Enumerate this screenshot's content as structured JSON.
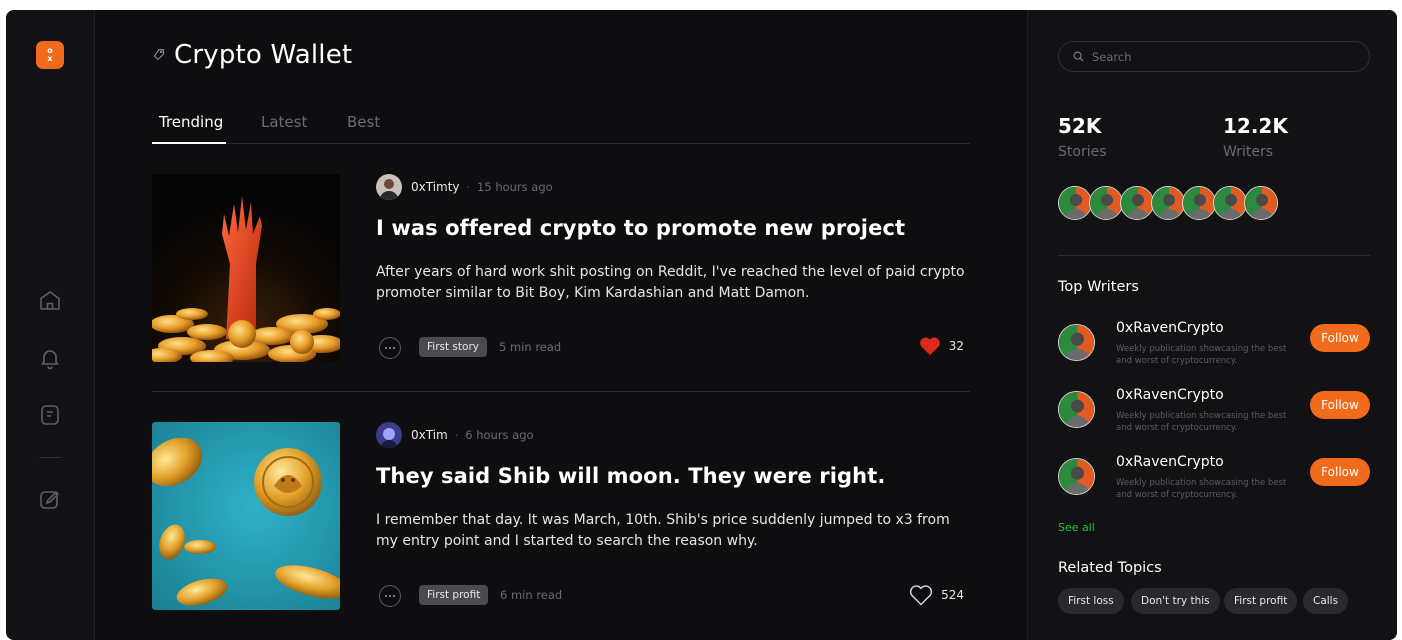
{
  "brand": {
    "logo_top": "o",
    "logo_bottom": "x",
    "accent": "#f26a1b"
  },
  "nav": {
    "items": [
      {
        "name": "home-icon"
      },
      {
        "name": "bell-icon"
      },
      {
        "name": "document-icon"
      },
      {
        "name": "edit-icon"
      }
    ]
  },
  "header": {
    "title": "Crypto Wallet",
    "icon": "tag-icon"
  },
  "tabs": [
    {
      "label": "Trending",
      "active": true
    },
    {
      "label": "Latest",
      "active": false
    },
    {
      "label": "Best",
      "active": false
    }
  ],
  "posts": [
    {
      "author": "0xTimty",
      "time": "15 hours ago",
      "title": "I was offered crypto to promote new project",
      "excerpt": "After years of hard work shit posting on Reddit, I've reached the level of paid crypto promoter similar to Bit Boy, Kim Kardashian and Matt Damon.",
      "tag": "First story",
      "read_time": "5 min read",
      "likes": "32",
      "liked": true
    },
    {
      "author": "0xTim",
      "time": "6 hours ago",
      "title": "They said Shib will moon. They were right.",
      "excerpt": "I remember that day. It was March, 10th. Shib's price suddenly jumped to x3 from my entry point and I started to search the reason why.",
      "tag": "First profit",
      "read_time": "6 min read",
      "likes": "524",
      "liked": false
    }
  ],
  "sidebar": {
    "search_placeholder": "Search",
    "stats": [
      {
        "value": "52K",
        "label": "Stories"
      },
      {
        "value": "12.2K",
        "label": "Writers"
      }
    ],
    "top_writers_title": "Top Writers",
    "writers": [
      {
        "name": "0xRavenCrypto",
        "desc": "Weekly publication showcasing the best and worst of cryptocurrency.",
        "follow": "Follow"
      },
      {
        "name": "0xRavenCrypto",
        "desc": "Weekly publication showcasing the best and worst of cryptocurrency.",
        "follow": "Follow"
      },
      {
        "name": "0xRavenCrypto",
        "desc": "Weekly publication showcasing the best and worst of cryptocurrency.",
        "follow": "Follow"
      }
    ],
    "see_all": "See all",
    "related_title": "Related Topics",
    "topics": [
      "First loss",
      "Don't try this",
      "First profit",
      "Calls"
    ]
  }
}
